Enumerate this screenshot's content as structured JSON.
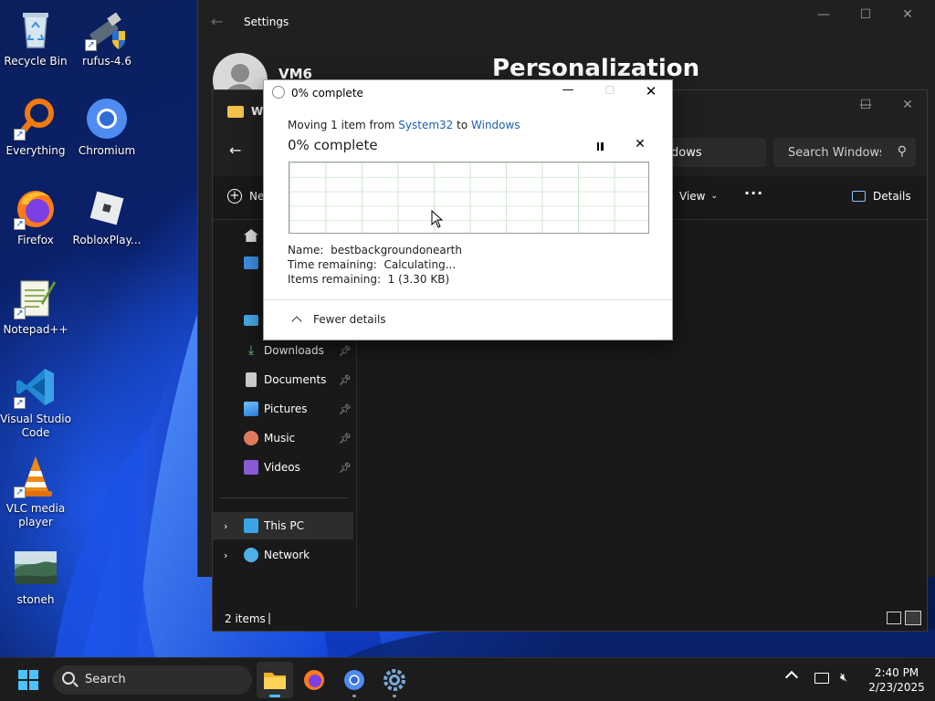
{
  "desktop": {
    "icons": [
      {
        "label": "Recycle Bin"
      },
      {
        "label": "rufus-4.6"
      },
      {
        "label": "Everything"
      },
      {
        "label": "Chromium"
      },
      {
        "label": "Firefox"
      },
      {
        "label": "RobloxPlay..."
      },
      {
        "label": "Notepad++"
      },
      {
        "label": "Visual Studio Code"
      },
      {
        "label": "VLC media player"
      },
      {
        "label": "stoneh"
      }
    ]
  },
  "settings_window": {
    "title": "Settings",
    "user_name": "VM6",
    "page_title": "Personalization"
  },
  "explorer_window": {
    "tab_title": "Wi",
    "search_placeholder": "Search Windows",
    "address_fragment": "dows",
    "toolbar": {
      "new_label": "Ne",
      "view_label": "View",
      "more_label": "...",
      "details_label": "Details"
    },
    "nav_items": [
      {
        "label": "Downloads"
      },
      {
        "label": "Documents"
      },
      {
        "label": "Pictures"
      },
      {
        "label": "Music"
      },
      {
        "label": "Videos"
      }
    ],
    "tree_items": [
      {
        "label": "This PC"
      },
      {
        "label": "Network"
      }
    ],
    "status_text": "2 items",
    "status_separator": "|"
  },
  "copy_dialog": {
    "title": "0% complete",
    "moving_prefix": "Moving 1 item from ",
    "source": "System32",
    "to_word": " to ",
    "destination": "Windows",
    "progress_heading": "0% complete",
    "progress_percent": 0,
    "name_label": "Name:",
    "name_value": "bestbackgroundonearth",
    "time_label": "Time remaining:",
    "time_value": "Calculating...",
    "items_label": "Items remaining:",
    "items_value": "1 (3.30 KB)",
    "fewer_details_label": "Fewer details",
    "colors": {
      "link": "#1a5fb4",
      "graph_grid": "#cfe6cf"
    }
  },
  "taskbar": {
    "search_label": "Search",
    "time": "2:40 PM",
    "date": "2/23/2025"
  }
}
